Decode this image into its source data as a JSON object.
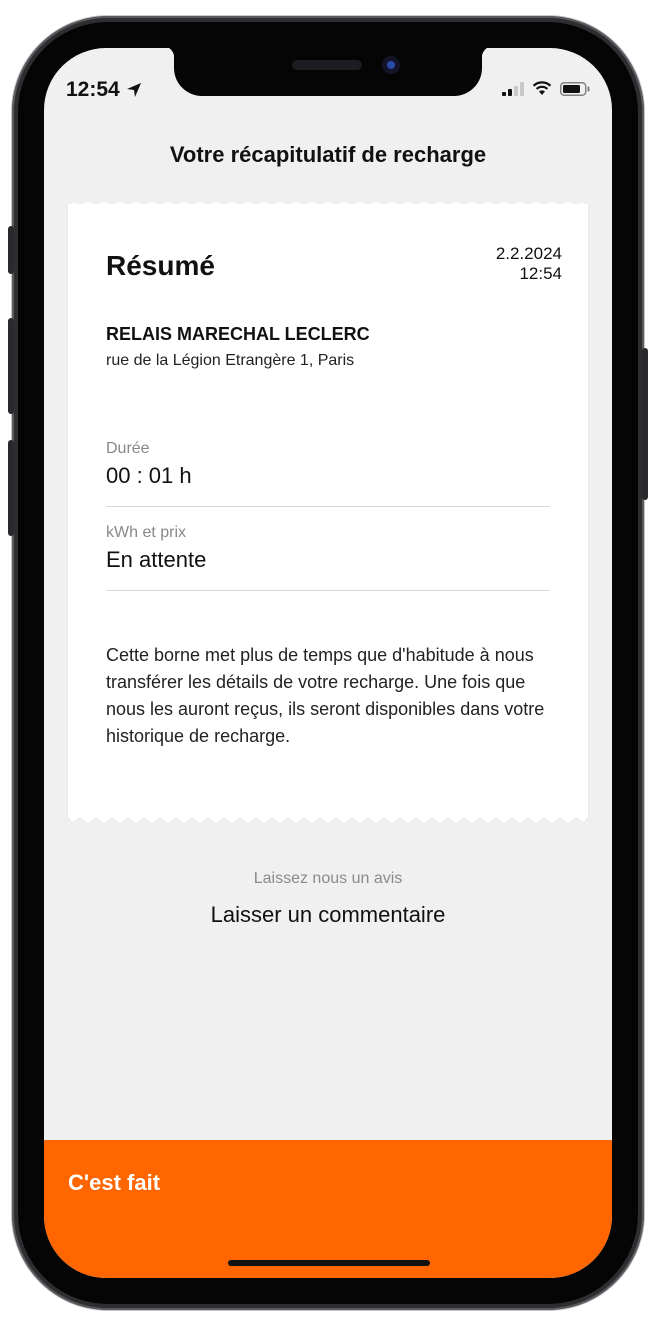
{
  "status_bar": {
    "time": "12:54"
  },
  "header": {
    "title": "Votre récapitulatif de recharge"
  },
  "summary": {
    "title": "Résumé",
    "date": "2.2.2024",
    "time": "12:54",
    "station_name": "RELAIS MARECHAL LECLERC",
    "station_address": "rue de la Légion Etrangère 1, Paris",
    "duration_label": "Durée",
    "duration_value": "00 : 01 h",
    "kwh_label": "kWh et prix",
    "kwh_value": "En attente",
    "notice": "Cette borne met plus de temps que d'habitude à nous transférer les détails de votre recharge. Une fois que nous les auront reçus, ils seront disponibles dans votre historique de recharge."
  },
  "review": {
    "label": "Laissez nous un avis",
    "link": "Laisser un commentaire"
  },
  "footer": {
    "done_label": "C'est fait"
  },
  "colors": {
    "accent": "#ff6600",
    "background": "#f0f0f0",
    "card": "#ffffff"
  }
}
